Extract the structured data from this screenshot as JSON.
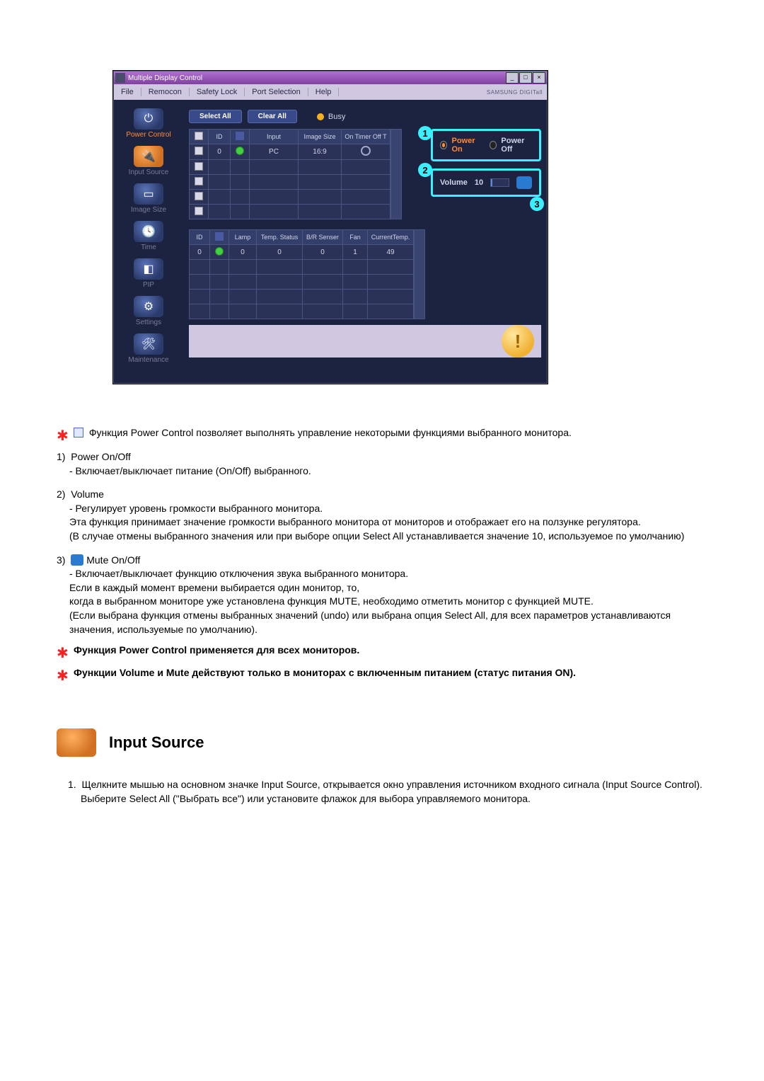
{
  "app": {
    "title": "Multiple Display Control",
    "menu": [
      "File",
      "Remocon",
      "Safety Lock",
      "Port Selection",
      "Help"
    ],
    "brand": "SAMSUNG DIGITall",
    "sidebar": [
      {
        "label": "Power Control",
        "active": true
      },
      {
        "label": "Input Source",
        "active": false
      },
      {
        "label": "Image Size",
        "active": false
      },
      {
        "label": "Time",
        "active": false
      },
      {
        "label": "PIP",
        "active": false
      },
      {
        "label": "Settings",
        "active": false
      },
      {
        "label": "Maintenance",
        "active": false
      }
    ],
    "buttons": {
      "select_all": "Select All",
      "clear_all": "Clear All"
    },
    "busy_label": "Busy",
    "table1": {
      "headers": [
        "☑",
        "ID",
        "",
        "Input",
        "Image Size",
        "On Timer Off T"
      ],
      "rows": [
        {
          "id": "0",
          "input": "PC",
          "image_size": "16:9"
        }
      ]
    },
    "table2": {
      "headers": [
        "ID",
        "",
        "Lamp",
        "Temp. Status",
        "B/R Senser",
        "Fan",
        "CurrentTemp."
      ],
      "rows": [
        {
          "id": "0",
          "lamp": "0",
          "temp_status": "0",
          "br": "0",
          "fan": "1",
          "ct": "49"
        }
      ]
    },
    "power": {
      "on": "Power On",
      "off": "Power Off"
    },
    "volume": {
      "label": "Volume",
      "value": "10"
    },
    "callouts": {
      "c1": "1",
      "c2": "2",
      "c3": "3"
    }
  },
  "doc": {
    "intro": "Функция Power Control позволяет выполнять управление некоторыми функциями выбранного монитора.",
    "items": [
      {
        "title": "Power On/Off",
        "lines": [
          "- Включает/выключает питание (On/Off) выбранного."
        ]
      },
      {
        "title": "Volume",
        "lines": [
          "- Регулирует уровень громкости выбранного монитора.",
          "Эта функция принимает значение громкости выбранного монитора от мониторов и отображает его на ползунке регулятора.",
          "(В случае отмены выбранного значения или при выборе опции Select All устанавливается значение 10, используемое по умолчанию)"
        ]
      },
      {
        "title": "Mute On/Off",
        "lines": [
          "- Включает/выключает функцию отключения звука выбранного монитора.",
          "Если в каждый момент времени выбирается один монитор, то,",
          "когда в выбранном мониторе уже установлена функция MUTE, необходимо отметить монитор с функцией MUTE.",
          "(Если выбрана функция отмены выбранных значений (undo) или выбрана опция Select All, для всех параметров устанавливаются значения, используемые по умолчанию)."
        ]
      }
    ],
    "note1": "Функция Power Control применяется для всех мониторов.",
    "note2": "Функции Volume и Mute действуют только в мониторах с включенным питанием (статус питания ON).",
    "section2_title": "Input Source",
    "section2_body1": "Щелкните мышью на основном значке Input Source, открывается окно управления источником входного сигнала (Input Source Control).",
    "section2_body2": "Выберите Select All (\"Выбрать все\") или установите флажок для выбора управляемого монитора."
  }
}
